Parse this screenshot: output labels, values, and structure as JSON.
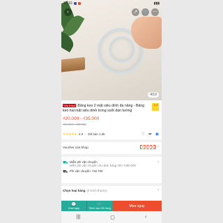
{
  "status": {
    "time": "12:10"
  },
  "gallery": {
    "counter": "4/10"
  },
  "product": {
    "mall_badge": "Yêu thích",
    "title": "Băng keo 2 mặt siêu dính đa năng - Băng keo hai mặt siêu dính trong suốt dán tường",
    "discount": "-8%",
    "price": "₫20.000 - ₫35.000",
    "old_price": "₫22.000 - ₫38.000",
    "rating": "4.9",
    "sold": "Đã bán 1,8k"
  },
  "voucher": {
    "label": "Voucher của Shop",
    "tag": "Giảm ₫5k"
  },
  "shipping": {
    "title": "Miễn phí vận chuyển",
    "desc": "Miễn phí vận chuyển cho đơn hàng trên ₫300.000",
    "fee": "Phí vận chuyển: ₫32.700"
  },
  "variant": {
    "label": "Chọn loại hàng",
    "hint": "(4 Kích thước)"
  },
  "bottom": {
    "chat": "Chat ngay",
    "cart": "Thêm vào Giỏ hàng",
    "buy": "Mua ngay"
  },
  "icons": {
    "back": "back-icon",
    "share": "share-icon",
    "cart": "cart-icon",
    "more": "more-icon"
  }
}
